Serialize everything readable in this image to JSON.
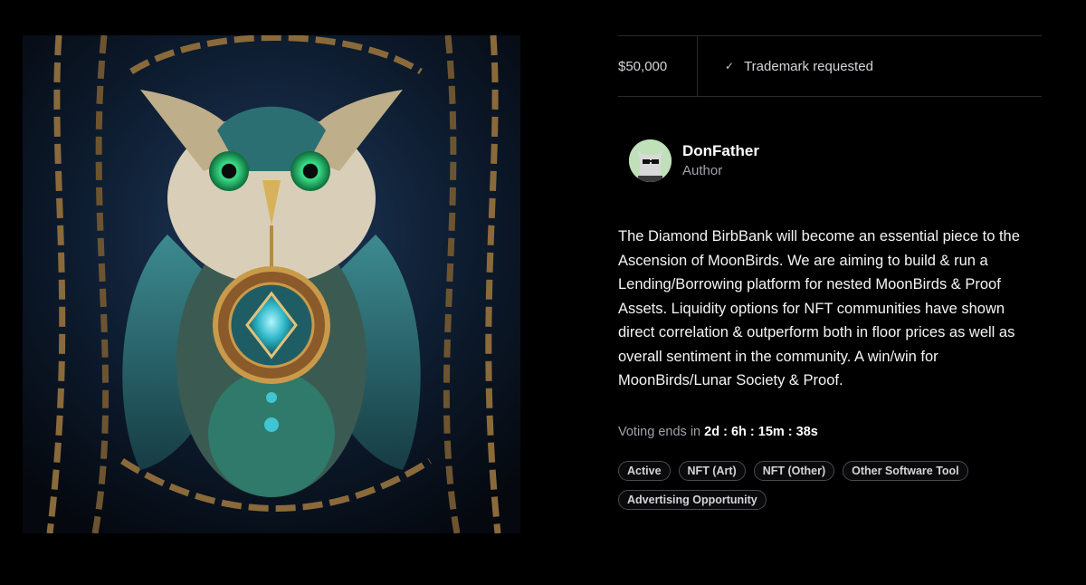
{
  "artwork": {
    "alt": "Owl artwork with chains and jeweled pendant"
  },
  "stats": {
    "price": "$50,000",
    "trademark_icon": "check-icon",
    "trademark_label": "Trademark requested"
  },
  "author": {
    "name": "DonFather",
    "role": "Author"
  },
  "description": "The Diamond BirbBank will become an essential piece to the Ascension of MoonBirds. We are aiming to build & run a Lending/Borrowing platform for nested MoonBirds & Proof Assets. Liquidity options for NFT communities have shown direct correlation & outperform both in floor prices as well as overall sentiment in the community. A win/win for MoonBirds/Lunar Society & Proof.",
  "voting": {
    "prefix": "Voting ends in",
    "countdown": "2d : 6h : 15m : 38s"
  },
  "tags": [
    "Active",
    "NFT (Art)",
    "NFT (Other)",
    "Other Software Tool",
    "Advertising Opportunity"
  ],
  "colors": {
    "background": "#000000",
    "border": "#2a2a2e",
    "muted_text": "#a1a1aa",
    "owl_teal": "#2f6b70",
    "owl_eye": "#34d27a",
    "chain_gold": "#8a6a3a"
  }
}
